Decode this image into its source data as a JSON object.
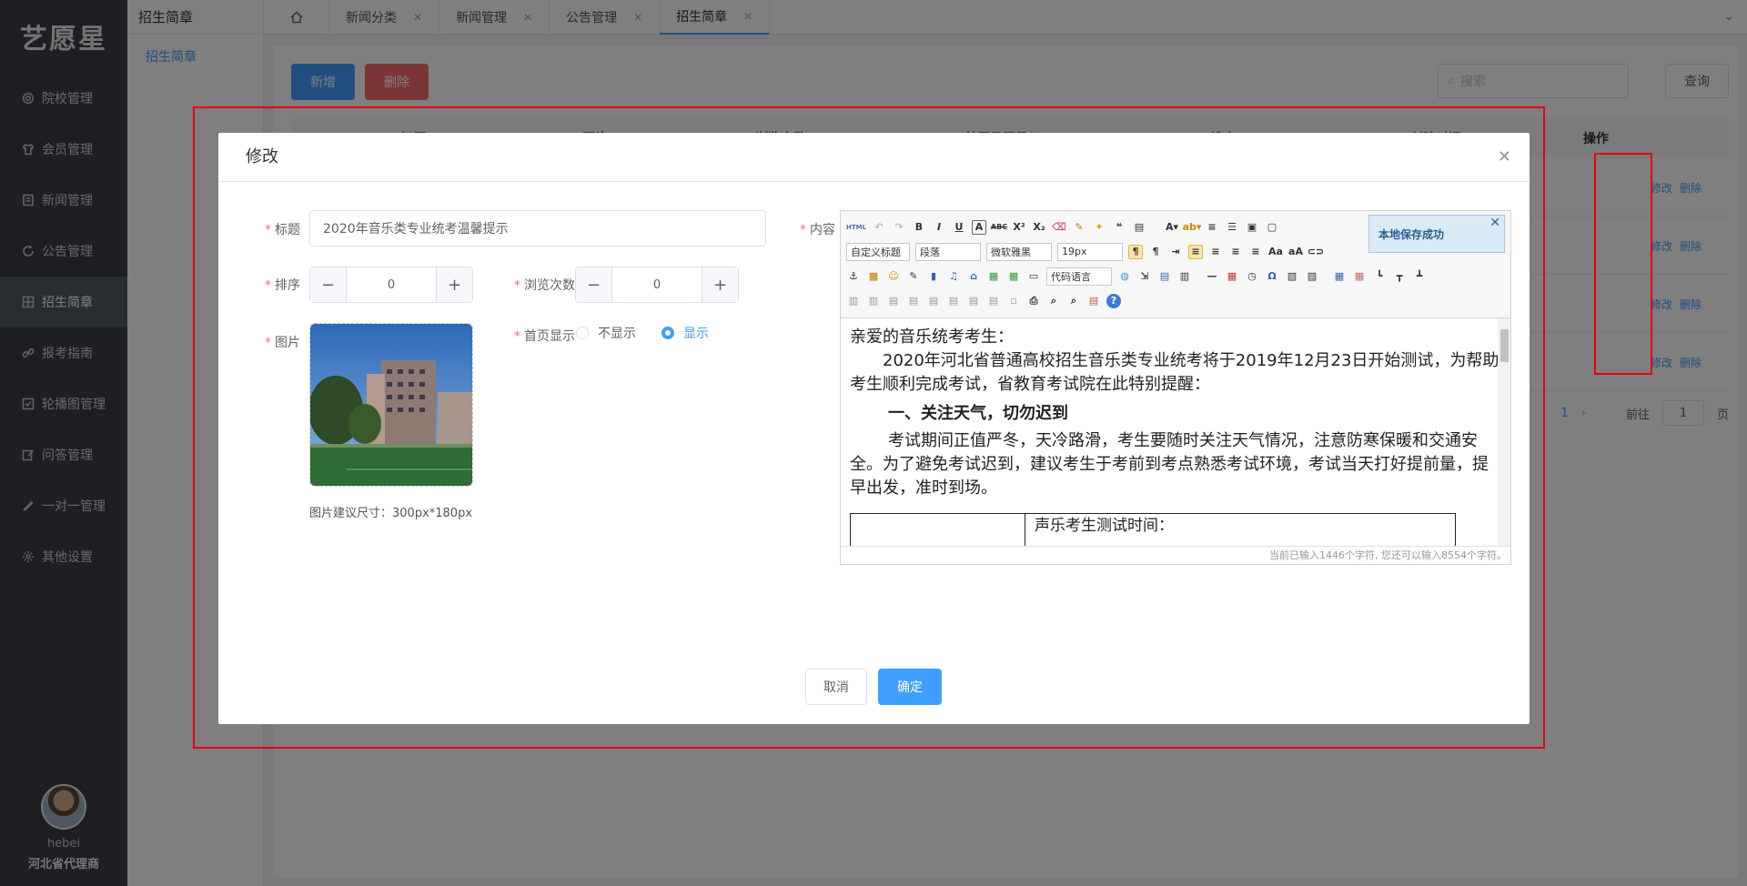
{
  "app": {
    "logo": "艺愿星"
  },
  "sidebar": {
    "items": [
      {
        "label": "院校管理",
        "icon": "gear-icon"
      },
      {
        "label": "会员管理",
        "icon": "shirt-icon"
      },
      {
        "label": "新闻管理",
        "icon": "document-icon"
      },
      {
        "label": "公告管理",
        "icon": "refresh-icon"
      },
      {
        "label": "招生简章",
        "icon": "grid-icon"
      },
      {
        "label": "报考指南",
        "icon": "link-icon"
      },
      {
        "label": "轮播图管理",
        "icon": "check-square-icon"
      },
      {
        "label": "问答管理",
        "icon": "edit-icon"
      },
      {
        "label": "一对一管理",
        "icon": "pen-icon"
      },
      {
        "label": "其他设置",
        "icon": "settings-icon"
      }
    ],
    "active_index": 4,
    "user": {
      "name": "hebei",
      "role": "河北省代理商"
    }
  },
  "subnav": {
    "title": "招生简章",
    "link": "招生简章"
  },
  "tabs": [
    {
      "label": "新闻分类"
    },
    {
      "label": "新闻管理"
    },
    {
      "label": "公告管理"
    },
    {
      "label": "招生简章",
      "active": true
    }
  ],
  "toolbar": {
    "add": "新增",
    "delete": "删除",
    "search_placeholder": "搜索",
    "query": "查询"
  },
  "table": {
    "headers": [
      "标题",
      "图片",
      "浏览次数",
      "首页是否显示",
      "排序",
      "创建时间",
      "操作"
    ],
    "row_ops": {
      "edit": "修改",
      "delete": "删除"
    },
    "pagination": {
      "current": "1",
      "goto_label": "前往",
      "goto_value": "1",
      "page_suffix": "页"
    }
  },
  "modal": {
    "title": "修改",
    "fields": {
      "title_label": "标题",
      "title_value": "2020年音乐类专业统考温馨提示",
      "sort_label": "排序",
      "sort_value": "0",
      "views_label": "浏览次数",
      "views_value": "0",
      "image_label": "图片",
      "image_hint": "图片建议尺寸：300px*180px",
      "homepage_label": "首页显示",
      "radio_hide": "不显示",
      "radio_show": "显示",
      "content_label": "内容"
    },
    "editor": {
      "selects": [
        "自定义标题",
        "段落",
        "微软雅黑",
        "19px",
        "代码语言"
      ],
      "toast": "本地保存成功",
      "para1": "亲爱的音乐统考考生：",
      "para2": "2020年河北省普通高校招生音乐类专业统考将于2019年12月23日开始测试，为帮助考生顺利完成考试，省教育考试院在此特别提醒：",
      "heading": "一、关注天气，切勿迟到",
      "para3": "考试期间正值严冬，天冷路滑，考生要随时关注天气情况，注意防寒保暖和交通安全。为了避免考试迟到，建议考生于考前到考点熟悉考试环境，考试当天打好提前量，提早出发，准时到场。",
      "table_cell": "声乐考生测试时间：",
      "footer": "当前已输入1446个字符, 您还可以输入8554个字符。"
    },
    "cancel": "取消",
    "confirm": "确定"
  },
  "colors": {
    "primary": "#409eff",
    "danger": "#f56c6c",
    "sidebar_bg": "#3a3f47",
    "highlight_border": "#e60012"
  }
}
